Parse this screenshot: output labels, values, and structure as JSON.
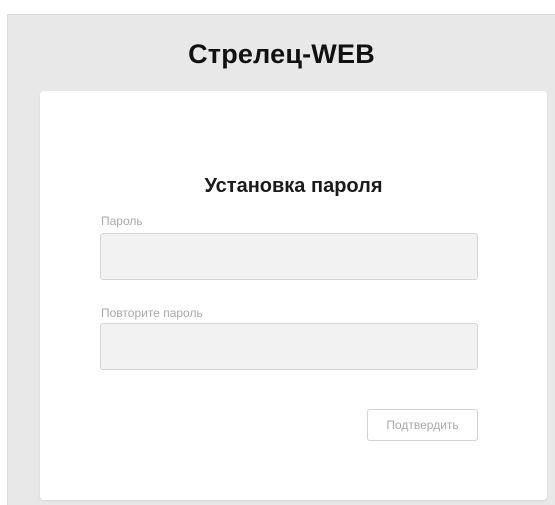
{
  "app": {
    "title": "Стрелец-WEB"
  },
  "form": {
    "title": "Установка пароля",
    "password": {
      "label": "Пароль",
      "value": "",
      "placeholder": ""
    },
    "repeat_password": {
      "label": "Повторите пароль",
      "value": "",
      "placeholder": ""
    },
    "submit_label": "Подтвердить"
  },
  "colors": {
    "page_background": "#e8e8e8",
    "card_background": "#ffffff",
    "input_background": "#f2f2f2",
    "label_text": "#a9a9a9",
    "title_text": "#111111"
  }
}
